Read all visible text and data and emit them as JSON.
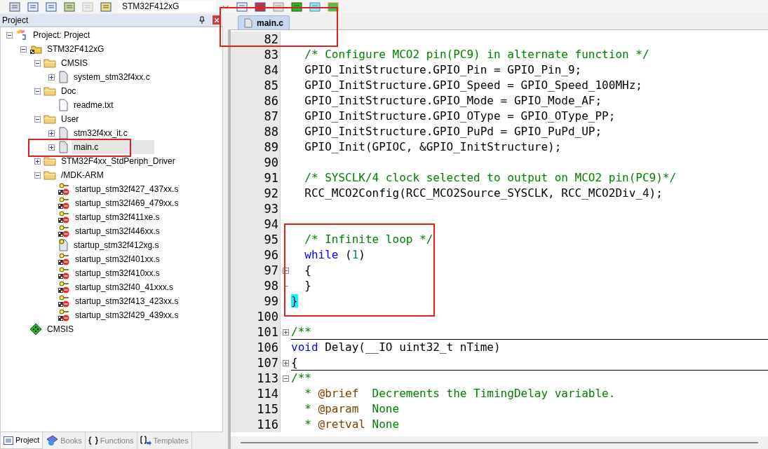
{
  "toolbar": {
    "target": "STM32F412xG"
  },
  "project_panel": {
    "title": "Project",
    "tree": [
      {
        "label": "Project: Project",
        "kind": "project",
        "expanded": true,
        "selected": false,
        "children": [
          {
            "label": "STM32F412xG",
            "kind": "target",
            "expanded": true,
            "selected": false,
            "children": [
              {
                "label": "CMSIS",
                "kind": "group",
                "expanded": true,
                "selected": false,
                "children": [
                  {
                    "label": "system_stm32f4xx.c",
                    "kind": "file",
                    "expanded": false,
                    "selected": false
                  }
                ]
              },
              {
                "label": "Doc",
                "kind": "group",
                "expanded": true,
                "selected": false,
                "children": [
                  {
                    "label": "readme.txt",
                    "kind": "text"
                  }
                ]
              },
              {
                "label": "User",
                "kind": "group",
                "expanded": true,
                "selected": false,
                "children": [
                  {
                    "label": "stm32f4xx_it.c",
                    "kind": "file",
                    "expanded": false,
                    "selected": false
                  },
                  {
                    "label": "main.c",
                    "kind": "file",
                    "expanded": false,
                    "selected": true
                  }
                ]
              },
              {
                "label": "STM32F4xx_StdPeriph_Driver",
                "kind": "group",
                "expanded": false,
                "selected": false
              },
              {
                "label": "/MDK-ARM",
                "kind": "group",
                "expanded": true,
                "selected": false,
                "children": [
                  {
                    "label": "startup_stm32f427_437xx.s",
                    "kind": "excluded"
                  },
                  {
                    "label": "startup_stm32f469_479xx.s",
                    "kind": "excluded"
                  },
                  {
                    "label": "startup_stm32f411xe.s",
                    "kind": "excluded"
                  },
                  {
                    "label": "startup_stm32f446xx.s",
                    "kind": "excluded"
                  },
                  {
                    "label": "startup_stm32f412xg.s",
                    "kind": "asm"
                  },
                  {
                    "label": "startup_stm32f401xx.s",
                    "kind": "excluded"
                  },
                  {
                    "label": "startup_stm32f410xx.s",
                    "kind": "excluded"
                  },
                  {
                    "label": "startup_stm32f40_41xxx.s",
                    "kind": "excluded"
                  },
                  {
                    "label": "startup_stm32f413_423xx.s",
                    "kind": "excluded"
                  },
                  {
                    "label": "startup_stm32f429_439xx.s",
                    "kind": "excluded"
                  }
                ]
              }
            ]
          },
          {
            "label": "CMSIS",
            "kind": "component"
          }
        ]
      }
    ],
    "tabs": [
      {
        "label": "Project",
        "kind": "project",
        "selected": true
      },
      {
        "label": "Books",
        "kind": "books",
        "selected": false
      },
      {
        "label": "Functions",
        "kind": "functions",
        "selected": false
      },
      {
        "label": "Templates",
        "kind": "templates",
        "selected": false
      }
    ]
  },
  "editor": {
    "tabs": [
      {
        "label": "main.c",
        "selected": true
      }
    ],
    "lines": [
      {
        "number": "82"
      },
      {
        "number": "83",
        "segments": [
          {
            "text": "  /* Configure MCO2 pin(PC9) in alternate function */",
            "kind": "comment"
          }
        ]
      },
      {
        "number": "84",
        "segments": [
          {
            "text": "  GPIO_InitStructure.GPIO_Pin = GPIO_Pin_9;",
            "kind": "plain"
          }
        ]
      },
      {
        "number": "85",
        "segments": [
          {
            "text": "  GPIO_InitStructure.GPIO_Speed = GPIO_Speed_100MHz;",
            "kind": "plain"
          }
        ]
      },
      {
        "number": "86",
        "segments": [
          {
            "text": "  GPIO_InitStructure.GPIO_Mode = GPIO_Mode_AF;",
            "kind": "plain"
          }
        ]
      },
      {
        "number": "87",
        "segments": [
          {
            "text": "  GPIO_InitStructure.GPIO_OType = GPIO_OType_PP;",
            "kind": "plain"
          }
        ]
      },
      {
        "number": "88",
        "segments": [
          {
            "text": "  GPIO_InitStructure.GPIO_PuPd = GPIO_PuPd_UP;",
            "kind": "plain"
          }
        ]
      },
      {
        "number": "89",
        "segments": [
          {
            "text": "  GPIO_Init(GPIOC, &GPIO_InitStructure);",
            "kind": "plain"
          }
        ]
      },
      {
        "number": "90"
      },
      {
        "number": "91",
        "segments": [
          {
            "text": "  /* SYSCLK/4 clock selected to output on MCO2 pin(PC9)*/",
            "kind": "comment"
          }
        ]
      },
      {
        "number": "92",
        "segments": [
          {
            "text": "  RCC_MCO2Config(RCC_MCO2Source_SYSCLK, RCC_MCO2Div_4);",
            "kind": "plain"
          }
        ]
      },
      {
        "number": "93"
      },
      {
        "number": "94"
      },
      {
        "number": "95",
        "segments": [
          {
            "text": "  /* Infinite loop */",
            "kind": "comment"
          }
        ]
      },
      {
        "number": "96",
        "segments": [
          {
            "text": "  while",
            "kind": "keyword"
          },
          {
            "text": " (",
            "kind": "plain"
          },
          {
            "text": "1",
            "kind": "number"
          },
          {
            "text": ")",
            "kind": "plain"
          }
        ]
      },
      {
        "number": "97",
        "fold": {
          "kind": "open"
        },
        "segments": [
          {
            "text": "  {",
            "kind": "plain"
          }
        ]
      },
      {
        "number": "98",
        "fold": {
          "kind": "end"
        },
        "segments": [
          {
            "text": "  }",
            "kind": "plain"
          }
        ]
      },
      {
        "number": "99",
        "segments": [
          {
            "text": "}",
            "kind": "brace-match"
          }
        ]
      },
      {
        "number": "100"
      },
      {
        "number": "101",
        "fold": {
          "kind": "collapsed"
        },
        "segments": [
          {
            "text": "/**",
            "kind": "comment"
          }
        ]
      },
      {
        "number": "106",
        "segments": [
          {
            "text": "void",
            "kind": "keyword"
          },
          {
            "text": " Delay(__IO uint32_t nTime)",
            "kind": "plain"
          }
        ]
      },
      {
        "number": "107",
        "fold": {
          "kind": "collapsed"
        },
        "segments": [
          {
            "text": "{",
            "kind": "plain"
          }
        ]
      },
      {
        "number": "113",
        "fold": {
          "kind": "open"
        },
        "segments": [
          {
            "text": "/**",
            "kind": "comment"
          }
        ]
      },
      {
        "number": "114",
        "segments": [
          {
            "text": "  * ",
            "kind": "comment"
          },
          {
            "text": "@brief",
            "kind": "doc-tag"
          },
          {
            "text": "  Decrements the TimingDelay variable.",
            "kind": "comment"
          }
        ]
      },
      {
        "number": "115",
        "segments": [
          {
            "text": "  * ",
            "kind": "comment"
          },
          {
            "text": "@param",
            "kind": "doc-tag"
          },
          {
            "text": "  None",
            "kind": "comment"
          }
        ]
      },
      {
        "number": "116",
        "segments": [
          {
            "text": "  * ",
            "kind": "comment"
          },
          {
            "text": "@retval",
            "kind": "doc-tag"
          },
          {
            "text": " None",
            "kind": "comment"
          }
        ]
      }
    ]
  }
}
